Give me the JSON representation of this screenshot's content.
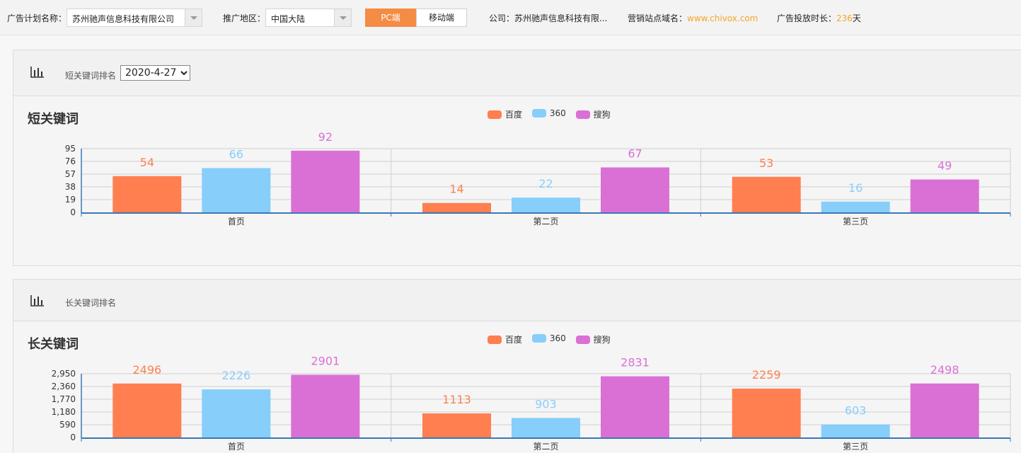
{
  "topbar": {
    "plan_label": "广告计划名称：",
    "plan_value": "苏州驰声信息科技有限公司",
    "region_label": "推广地区：",
    "region_value": "中国大陆",
    "pc_tab": "PC端",
    "mobile_tab": "移动端",
    "company_label": "公司：苏州驰声信息科技有限...",
    "domain_label": "营销站点域名：",
    "domain_value": "www.chivox.com",
    "duration_label": "广告投放时长：",
    "duration_value": "236",
    "duration_unit": "天"
  },
  "panels": [
    {
      "caption": "短关键词排名",
      "date": "2020-4-27",
      "title": "短关键词",
      "legend": [
        "百度",
        "360",
        "搜狗"
      ]
    },
    {
      "caption": "长关键词排名",
      "title": "长关键词",
      "legend": [
        "百度",
        "360",
        "搜狗"
      ]
    }
  ],
  "colors": {
    "baidu": "#ff7f50",
    "s360": "#87cefa",
    "sogou": "#da70d6",
    "axis": "#3a78b5",
    "accent": "#f48c45"
  },
  "chart_data": [
    {
      "type": "bar",
      "title": "短关键词",
      "categories": [
        "首页",
        "第二页",
        "第三页"
      ],
      "series": [
        {
          "name": "百度",
          "values": [
            54,
            14,
            53
          ]
        },
        {
          "name": "360",
          "values": [
            66,
            22,
            16
          ]
        },
        {
          "name": "搜狗",
          "values": [
            92,
            67,
            49
          ]
        }
      ],
      "yticks": [
        "0",
        "19",
        "38",
        "57",
        "76",
        "95"
      ],
      "ylim": [
        0,
        95
      ],
      "grid": true,
      "legend_position": "top-center"
    },
    {
      "type": "bar",
      "title": "长关键词",
      "categories": [
        "首页",
        "第二页",
        "第三页"
      ],
      "series": [
        {
          "name": "百度",
          "values": [
            2496,
            1113,
            2259
          ]
        },
        {
          "name": "360",
          "values": [
            2226,
            903,
            603
          ]
        },
        {
          "name": "搜狗",
          "values": [
            2901,
            2831,
            2498
          ]
        }
      ],
      "yticks": [
        "0",
        "590",
        "1,180",
        "1,770",
        "2,360",
        "2,950"
      ],
      "ylim": [
        0,
        2950
      ],
      "grid": true,
      "legend_position": "top-center"
    }
  ]
}
